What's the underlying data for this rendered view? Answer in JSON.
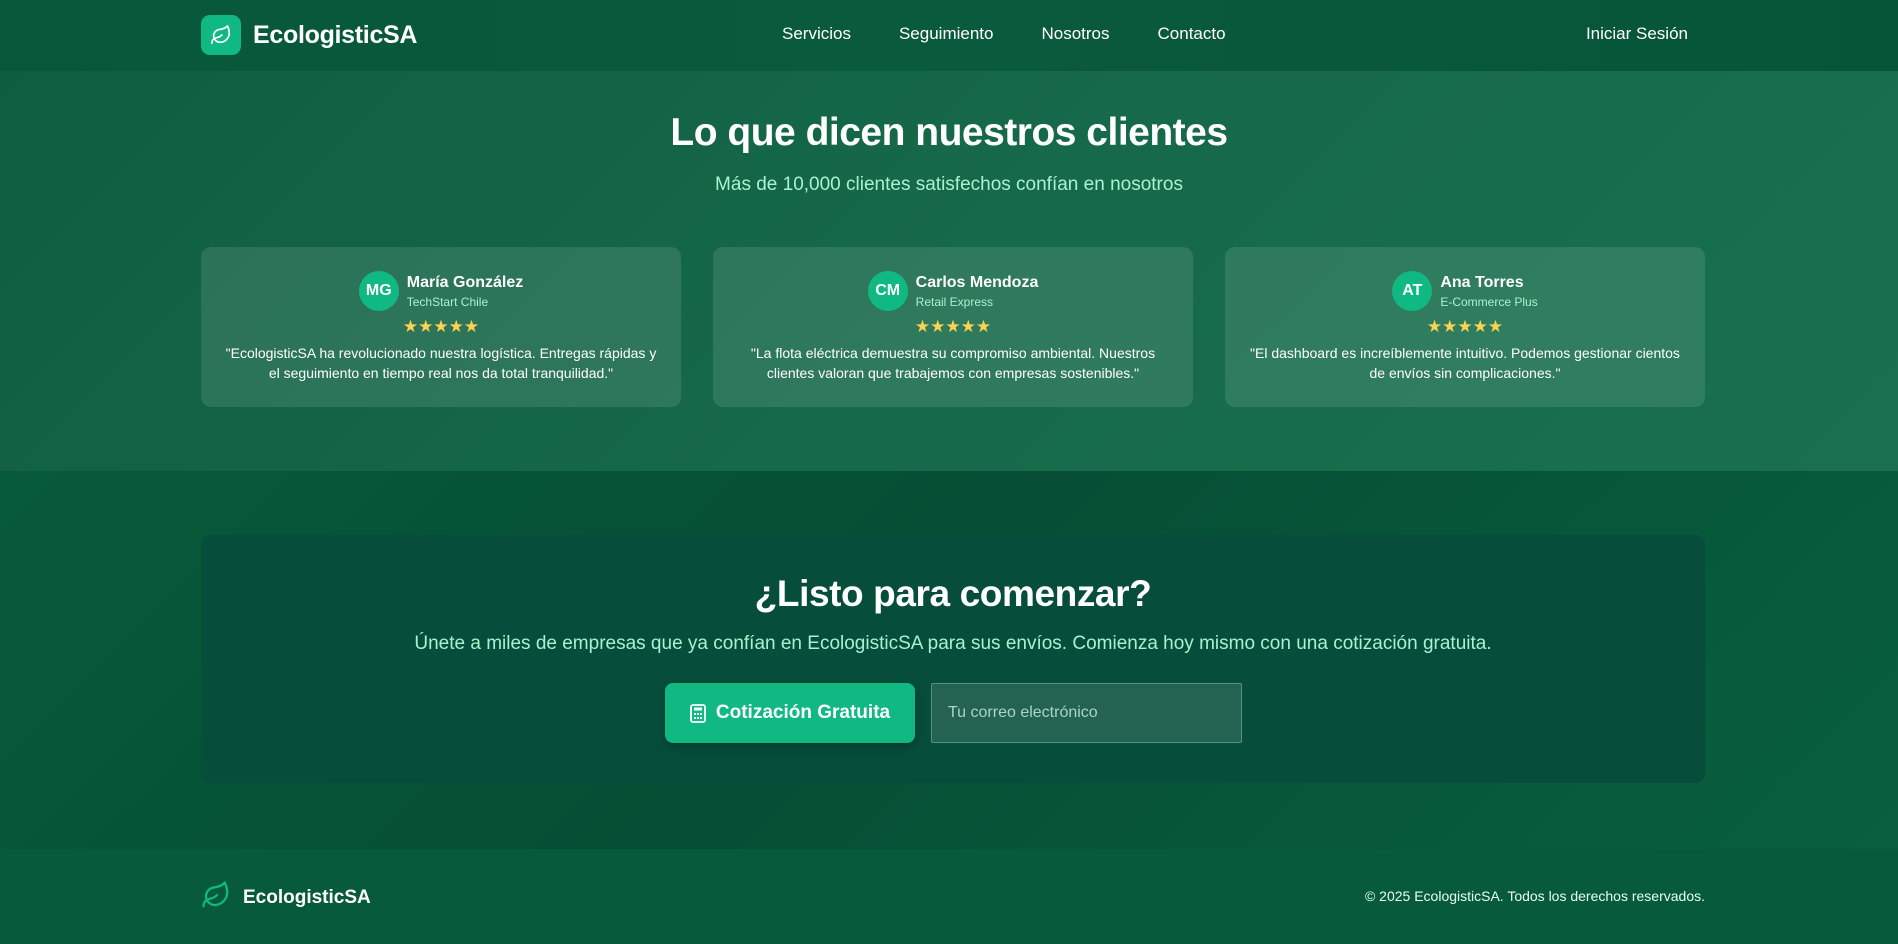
{
  "colors": {
    "accent": "#10b981",
    "stars": "#fcd34d",
    "subtle_text": "#a7f3d0",
    "background": "#075a3c"
  },
  "header": {
    "brand": "EcologisticSA",
    "logo_icon": "leaf-icon",
    "nav": [
      "Servicios",
      "Seguimiento",
      "Nosotros",
      "Contacto"
    ],
    "login": "Iniciar Sesión"
  },
  "testimonials": {
    "title": "Lo que dicen nuestros clientes",
    "subtitle": "Más de 10,000 clientes satisfechos confían en nosotros",
    "items": [
      {
        "initials": "MG",
        "name": "María González",
        "company": "TechStart Chile",
        "rating": 5,
        "stars": "★★★★★",
        "quote": "\"EcologisticSA ha revolucionado nuestra logística. Entregas rápidas y el seguimiento en tiempo real nos da total tranquilidad.\""
      },
      {
        "initials": "CM",
        "name": "Carlos Mendoza",
        "company": "Retail Express",
        "rating": 5,
        "stars": "★★★★★",
        "quote": "\"La flota eléctrica demuestra su compromiso ambiental. Nuestros clientes valoran que trabajemos con empresas sostenibles.\""
      },
      {
        "initials": "AT",
        "name": "Ana Torres",
        "company": "E-Commerce Plus",
        "rating": 5,
        "stars": "★★★★★",
        "quote": "\"El dashboard es increíblemente intuitivo. Podemos gestionar cientos de envíos sin complicaciones.\""
      }
    ]
  },
  "cta": {
    "title": "¿Listo para comenzar?",
    "text": "Únete a miles de empresas que ya confían en EcologisticSA para sus envíos. Comienza hoy mismo con una cotización gratuita.",
    "button_label": "Cotización Gratuita",
    "button_icon": "calculator-icon",
    "email_placeholder": "Tu correo electrónico",
    "email_value": ""
  },
  "footer": {
    "brand": "EcologisticSA",
    "logo_icon": "leaf-icon",
    "copyright": "© 2025 EcologisticSA. Todos los derechos reservados."
  }
}
